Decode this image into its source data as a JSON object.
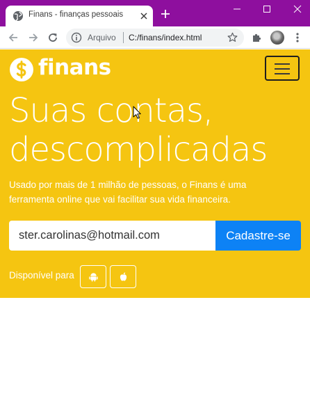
{
  "browser": {
    "tab_title": "Finans - finanças pessoais",
    "omnibox_site": "Arquivo",
    "omnibox_url": "C:/finans/index.html"
  },
  "page": {
    "brand": "finans",
    "headline_line1": "Suas contas,",
    "headline_line2": "descomplicadas",
    "subtitle_line1": "Usado por mais de 1 milhão de pessoas, o Finans é uma",
    "subtitle_line2": "ferramenta online que vai facilitar sua vida financeira.",
    "email_value": "ster.carolinas@hotmail.com",
    "signup_label": "Cadastre-se",
    "available_label": "Disponível para"
  },
  "icons": {
    "favicon": "globe-icon",
    "close": "close-icon",
    "new_tab": "plus-icon",
    "back": "arrow-left-icon",
    "forward": "arrow-right-icon",
    "reload": "reload-icon",
    "info": "info-icon",
    "bookmark": "star-icon",
    "extensions": "puzzle-icon",
    "menu": "kebab-menu-icon",
    "logo": "dollar-coin-icon",
    "hamburger": "hamburger-icon",
    "android": "android-icon",
    "apple": "apple-icon"
  },
  "colors": {
    "tabstrip": "#8e0f9e",
    "hero": "#f5c511",
    "button": "#0d82f5"
  }
}
